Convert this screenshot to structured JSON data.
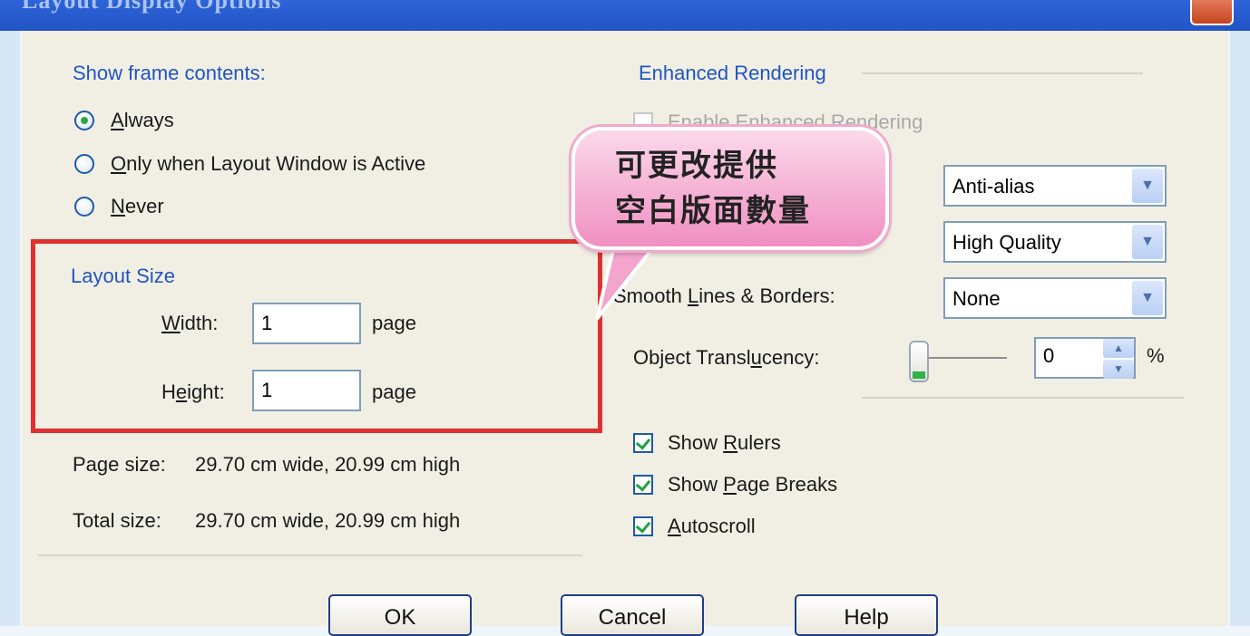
{
  "window": {
    "title": "Layout Display Options"
  },
  "frame_contents": {
    "heading": "Show frame contents:",
    "options": [
      {
        "pre": "",
        "key": "A",
        "post": "lways",
        "checked": true
      },
      {
        "pre": "",
        "key": "O",
        "post": "nly when Layout Window is Active",
        "checked": false
      },
      {
        "pre": "",
        "key": "N",
        "post": "ever",
        "checked": false
      }
    ]
  },
  "layout_size": {
    "heading": "Layout Size",
    "width_label_key": "W",
    "width_label_rest": "idth:",
    "width_value": "1",
    "width_unit": "page",
    "height_label_pre": "H",
    "height_label_key": "e",
    "height_label_rest": "ight:",
    "height_value": "1",
    "height_unit": "page"
  },
  "sizes": {
    "page_label": "Page size:",
    "page_value": "29.70 cm wide, 20.99 cm high",
    "total_label": "Total size:",
    "total_value": "29.70 cm wide, 20.99 cm high"
  },
  "enhanced": {
    "heading": "Enhanced Rendering",
    "enable_label": "Enable Enhanced Rendering",
    "dropdown_1": "Anti-alias",
    "dropdown_2": "High Quality",
    "smooth_label_pre": "Smooth ",
    "smooth_label_key": "L",
    "smooth_label_rest": "ines & Borders:",
    "dropdown_3": "None",
    "translucency_label_pre": "Object Transl",
    "translucency_label_key": "u",
    "translucency_label_rest": "cency:",
    "translucency_value": "0",
    "translucency_unit": "%",
    "translucency_level": 0
  },
  "checks": [
    {
      "pre": "Show ",
      "key": "R",
      "post": "ulers",
      "checked": true
    },
    {
      "pre": "Show ",
      "key": "P",
      "post": "age Breaks",
      "checked": true
    },
    {
      "pre": "",
      "key": "A",
      "post": "utoscroll",
      "checked": true
    }
  ],
  "buttons": {
    "ok": "OK",
    "cancel": "Cancel",
    "help": "Help"
  },
  "callout": {
    "line1": "可更改提供",
    "line2": "空白版面數量"
  }
}
